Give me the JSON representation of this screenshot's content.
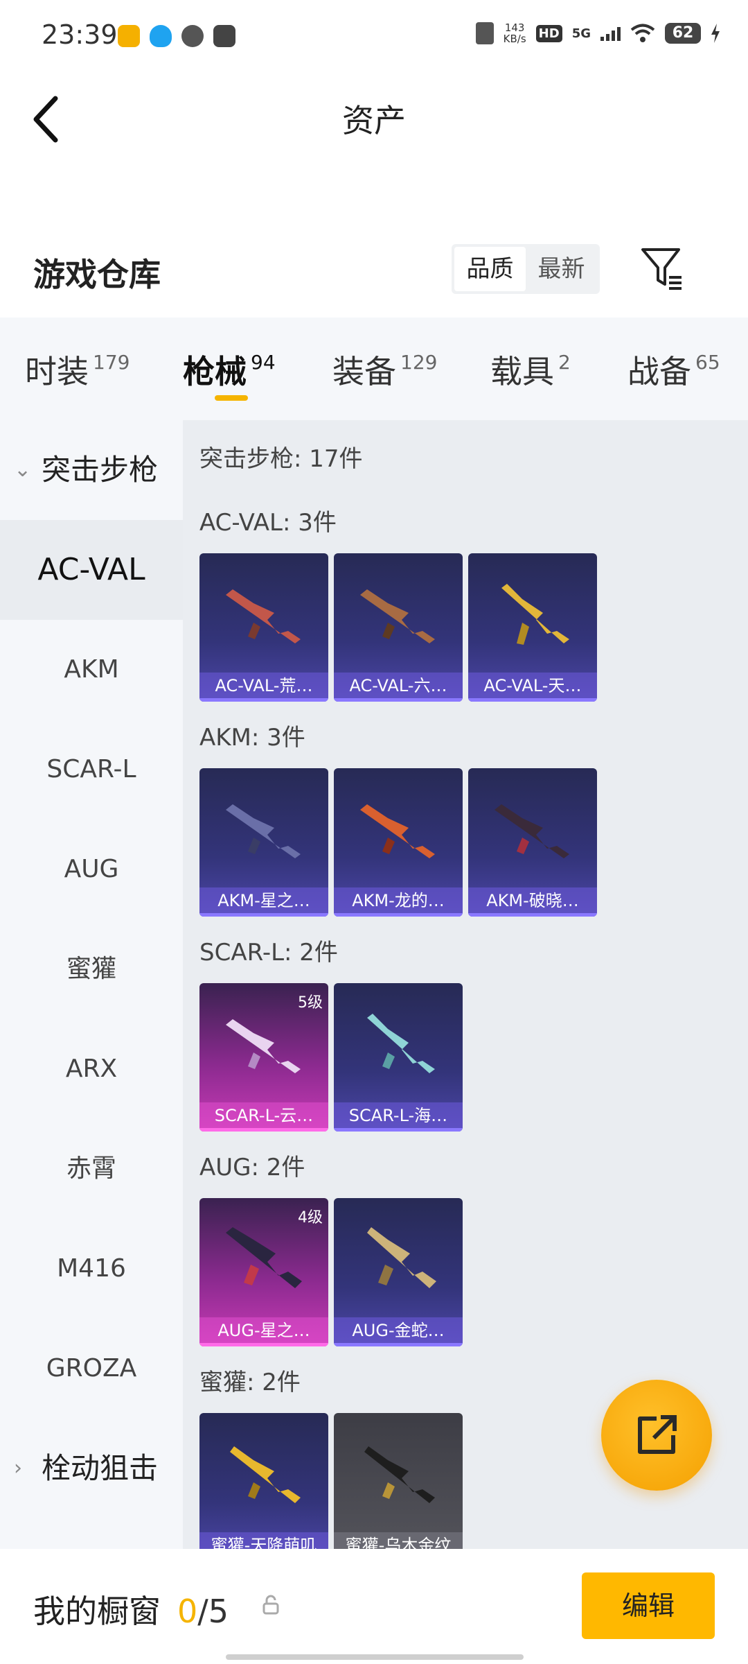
{
  "status_bar": {
    "time": "23:39",
    "net_speed_value": "143",
    "net_speed_unit": "KB/s",
    "hd": "HD",
    "network": "5G",
    "battery": "62"
  },
  "header": {
    "title": "资产"
  },
  "warehouse": {
    "title": "游戏仓库",
    "sort_options": [
      "品质",
      "最新"
    ],
    "sort_selected": "品质"
  },
  "tabs": [
    {
      "label": "时装",
      "count": "179"
    },
    {
      "label": "枪械",
      "count": "94"
    },
    {
      "label": "装备",
      "count": "129"
    },
    {
      "label": "载具",
      "count": "2"
    },
    {
      "label": "战备",
      "count": "65"
    }
  ],
  "active_tab": "枪械",
  "sidebar": {
    "group_open": "突击步枪",
    "items": [
      "AC-VAL",
      "AKM",
      "SCAR-L",
      "AUG",
      "蜜獾",
      "ARX",
      "赤霄",
      "M416",
      "GROZA"
    ],
    "selected": "AC-VAL",
    "group_closed": "栓动狙击"
  },
  "content": {
    "total_line": "突击步枪: 17件",
    "groups": [
      {
        "header": "AC-VAL: 3件",
        "items": [
          {
            "name": "AC-VAL-荒…",
            "rarity": "purple",
            "level": ""
          },
          {
            "name": "AC-VAL-六…",
            "rarity": "purple",
            "level": ""
          },
          {
            "name": "AC-VAL-天…",
            "rarity": "purple",
            "level": ""
          }
        ]
      },
      {
        "header": "AKM: 3件",
        "items": [
          {
            "name": "AKM-星之…",
            "rarity": "purple",
            "level": ""
          },
          {
            "name": "AKM-龙的…",
            "rarity": "purple",
            "level": ""
          },
          {
            "name": "AKM-破晓…",
            "rarity": "purple",
            "level": ""
          }
        ]
      },
      {
        "header": "SCAR-L: 2件",
        "items": [
          {
            "name": "SCAR-L-云…",
            "rarity": "pink",
            "level": "5级"
          },
          {
            "name": "SCAR-L-海…",
            "rarity": "purple",
            "level": ""
          }
        ]
      },
      {
        "header": "AUG: 2件",
        "items": [
          {
            "name": "AUG-星之…",
            "rarity": "pink",
            "level": "4级"
          },
          {
            "name": "AUG-金蛇…",
            "rarity": "purple",
            "level": ""
          }
        ]
      },
      {
        "header": "蜜獾: 2件",
        "items": [
          {
            "name": "蜜獾-天降萌叽",
            "rarity": "purple",
            "level": ""
          },
          {
            "name": "蜜獾-乌木金纹",
            "rarity": "grey",
            "level": ""
          }
        ]
      }
    ]
  },
  "showcase": {
    "label": "我的橱窗",
    "used": "0",
    "total": "/5",
    "edit_label": "编辑"
  },
  "colors": {
    "accent": "#f5b400",
    "purple_card": "#33347a",
    "pink_card": "#c93bb6"
  },
  "icons": {
    "back": "chevron-left-icon",
    "filter": "filter-icon",
    "share": "share-external-icon",
    "lock": "lock-icon"
  }
}
